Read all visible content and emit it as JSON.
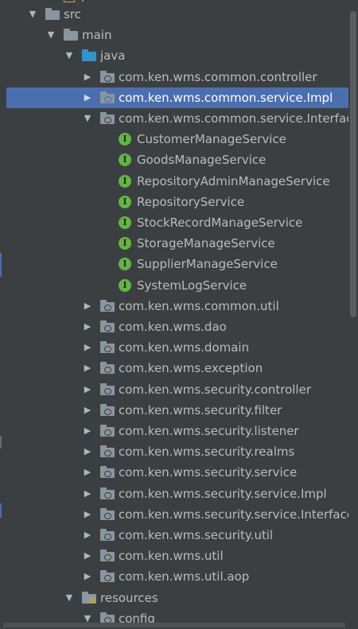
{
  "header_clipped_label": "p",
  "colors": {
    "background": "#3c3f41",
    "selection": "#4b6eaf",
    "text": "#bbbbbb",
    "interface_badge": "#62b543",
    "source_folder": "#3592c4",
    "folder": "#8b959e"
  },
  "tree": [
    {
      "label": "src",
      "arrow": "▼",
      "icon": "folder-icon",
      "selected": false
    },
    {
      "label": "main",
      "arrow": "▼",
      "icon": "folder-icon",
      "selected": false
    },
    {
      "label": "java",
      "arrow": "▼",
      "icon": "source-folder-icon",
      "selected": false
    },
    {
      "label": "com.ken.wms.common.controller",
      "arrow": "▶",
      "icon": "package-icon",
      "selected": false
    },
    {
      "label": "com.ken.wms.common.service.Impl",
      "arrow": "▶",
      "icon": "package-icon",
      "selected": true
    },
    {
      "label": "com.ken.wms.common.service.Interface",
      "arrow": "▼",
      "icon": "package-icon",
      "selected": false
    },
    {
      "label": "CustomerManageService",
      "arrow": "",
      "icon": "interface-icon",
      "badge": "I",
      "selected": false
    },
    {
      "label": "GoodsManageService",
      "arrow": "",
      "icon": "interface-icon",
      "badge": "I",
      "selected": false
    },
    {
      "label": "RepositoryAdminManageService",
      "arrow": "",
      "icon": "interface-icon",
      "badge": "I",
      "selected": false
    },
    {
      "label": "RepositoryService",
      "arrow": "",
      "icon": "interface-icon",
      "badge": "I",
      "selected": false
    },
    {
      "label": "StockRecordManageService",
      "arrow": "",
      "icon": "interface-icon",
      "badge": "I",
      "selected": false
    },
    {
      "label": "StorageManageService",
      "arrow": "",
      "icon": "interface-icon",
      "badge": "I",
      "selected": false
    },
    {
      "label": "SupplierManageService",
      "arrow": "",
      "icon": "interface-icon",
      "badge": "I",
      "selected": false
    },
    {
      "label": "SystemLogService",
      "arrow": "",
      "icon": "interface-icon",
      "badge": "I",
      "selected": false
    },
    {
      "label": "com.ken.wms.common.util",
      "arrow": "▶",
      "icon": "package-icon",
      "selected": false
    },
    {
      "label": "com.ken.wms.dao",
      "arrow": "▶",
      "icon": "package-icon",
      "selected": false
    },
    {
      "label": "com.ken.wms.domain",
      "arrow": "▶",
      "icon": "package-icon",
      "selected": false
    },
    {
      "label": "com.ken.wms.exception",
      "arrow": "▶",
      "icon": "package-icon",
      "selected": false
    },
    {
      "label": "com.ken.wms.security.controller",
      "arrow": "▶",
      "icon": "package-icon",
      "selected": false
    },
    {
      "label": "com.ken.wms.security.filter",
      "arrow": "▶",
      "icon": "package-icon",
      "selected": false
    },
    {
      "label": "com.ken.wms.security.listener",
      "arrow": "▶",
      "icon": "package-icon",
      "selected": false
    },
    {
      "label": "com.ken.wms.security.realms",
      "arrow": "▶",
      "icon": "package-icon",
      "selected": false
    },
    {
      "label": "com.ken.wms.security.service",
      "arrow": "▶",
      "icon": "package-icon",
      "selected": false
    },
    {
      "label": "com.ken.wms.security.service.Impl",
      "arrow": "▶",
      "icon": "package-icon",
      "selected": false
    },
    {
      "label": "com.ken.wms.security.service.Interface",
      "arrow": "▶",
      "icon": "package-icon",
      "selected": false
    },
    {
      "label": "com.ken.wms.security.util",
      "arrow": "▶",
      "icon": "package-icon",
      "selected": false
    },
    {
      "label": "com.ken.wms.util",
      "arrow": "▶",
      "icon": "package-icon",
      "selected": false
    },
    {
      "label": "com.ken.wms.util.aop",
      "arrow": "▶",
      "icon": "package-icon",
      "selected": false
    },
    {
      "label": "resources",
      "arrow": "▼",
      "icon": "resources-folder-icon",
      "selected": false
    },
    {
      "label": "config",
      "arrow": "▼",
      "icon": "package-icon",
      "selected": false
    }
  ]
}
